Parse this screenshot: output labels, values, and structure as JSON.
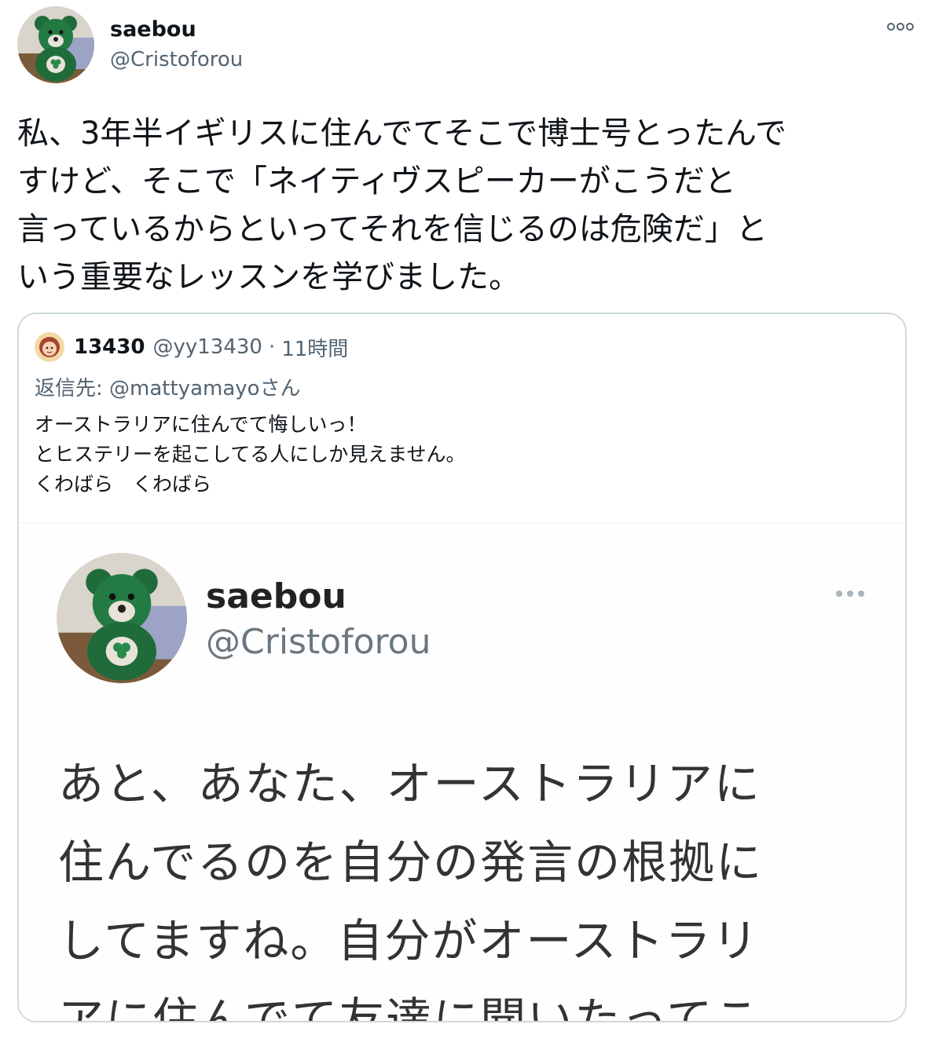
{
  "tweet": {
    "author": {
      "display_name": "saebou",
      "handle": "@Cristoforou",
      "avatar": "green-bear-avatar"
    },
    "more_icon": "more-horizontal-icon",
    "text_lines": [
      "私、3年半イギリスに住んでてそこで博士号とったんで",
      "すけど、そこで「ネイティヴスピーカーがこうだと",
      "言っているからといってそれを信じるのは危険だ」と",
      "いう重要なレッスンを学びました。"
    ]
  },
  "quote": {
    "author": {
      "display_name": "13430",
      "handle": "@yy13430",
      "dot": "·",
      "time": "11時間",
      "avatar": "illustrated-avatar"
    },
    "reply_to": {
      "prefix": "返信先: ",
      "mention": "@mattyamayo",
      "suffix": "さん"
    },
    "text_lines": [
      "オーストラリアに住んでて悔しいっ！",
      "とヒステリーを起こしてる人にしか見えません。",
      "くわばら　くわばら"
    ],
    "media": {
      "author": {
        "display_name": "saebou",
        "handle": "@Cristoforou"
      },
      "more_icon": "more-horizontal-icon",
      "text_lines": [
        "あと、あなた、オーストラリアに",
        "住んでるのを自分の発言の根拠に",
        "してますね。自分がオーストラリ",
        "アに住んでて友達に聞いたってこ"
      ]
    }
  },
  "colors": {
    "text": "#0f1419",
    "secondary": "#536471",
    "border": "#cfd9de",
    "bear_green": "#1f6b3a"
  }
}
